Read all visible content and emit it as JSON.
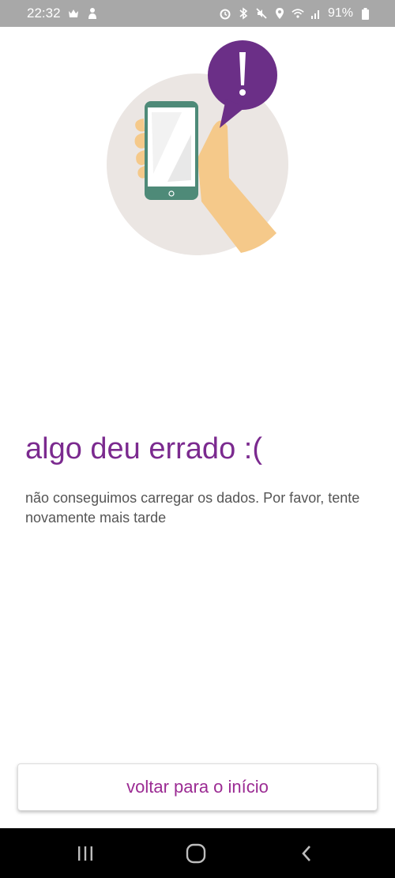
{
  "status_bar": {
    "time": "22:32",
    "battery": "91%",
    "left_icons": [
      "notification-icon",
      "app-notification-icon"
    ],
    "right_icons": [
      "alarm-icon",
      "bluetooth-icon",
      "mute-icon",
      "location-icon",
      "wifi-icon",
      "signal-icon",
      "battery-icon"
    ]
  },
  "error": {
    "title": "algo deu errado :(",
    "message": "não conseguimos carregar os dados. Por favor, tente novamente mais tarde"
  },
  "action": {
    "home_label": "voltar para o início"
  },
  "nav": {
    "icons": [
      "recent-apps-icon",
      "home-icon",
      "back-icon"
    ]
  },
  "colors": {
    "accent": "#7b2a8f",
    "button_text": "#9b2b93",
    "illustration_bubble": "#6b2f87",
    "illustration_circle": "#ebe6e3",
    "hand": "#f5c98a",
    "phone_frame": "#4e8a78"
  }
}
